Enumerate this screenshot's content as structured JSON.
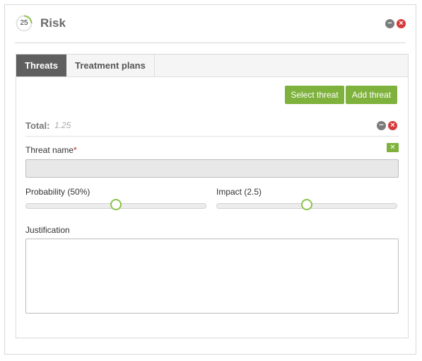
{
  "header": {
    "gauge_value": "25",
    "title": "Risk"
  },
  "tabs": [
    {
      "label": "Threats",
      "active": true
    },
    {
      "label": "Treatment plans",
      "active": false
    }
  ],
  "actions": {
    "select_threat": "Select threat",
    "add_threat": "Add threat"
  },
  "total": {
    "label": "Total:",
    "value": "1.25"
  },
  "form": {
    "threat_name_label": "Threat name",
    "required_mark": "*",
    "threat_name_value": "",
    "probability_label": "Probability (50%)",
    "probability_level": 0.5,
    "impact_label": "Impact (2.5)",
    "impact_level": 0.5,
    "justification_label": "Justification",
    "justification_value": ""
  },
  "colors": {
    "accent_green": "#7fb23c",
    "tab_active": "#5f5f5f",
    "close_red": "#d73a3a"
  },
  "icons": [
    "gauge-icon",
    "minimize-icon",
    "close-icon",
    "clear-icon",
    "resize-grip-icon"
  ]
}
